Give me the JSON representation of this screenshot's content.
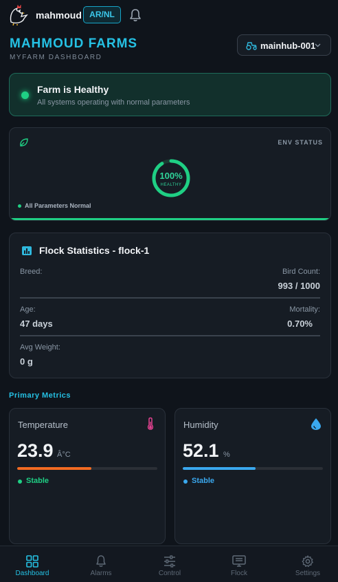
{
  "topbar": {
    "username": "mahmoud",
    "lang_label": "AR/NL"
  },
  "header": {
    "farm_name": "MAHMOUD FARMS",
    "subtitle": "MYFARM DASHBOARD",
    "hub": "mainhub-001"
  },
  "health": {
    "title": "Farm is Healthy",
    "subtitle": "All systems operating with normal parameters"
  },
  "env": {
    "status_label": "ENV STATUS",
    "percent_text": "100%",
    "percent_value": 100,
    "state_label": "HEALTHY",
    "note": "All Parameters Normal"
  },
  "flock": {
    "title": "Flock Statistics - flock-1",
    "breed_label": "Breed:",
    "breed_value": "",
    "bird_count_label": "Bird Count:",
    "bird_count_value": "993 / 1000",
    "age_label": "Age:",
    "age_value": "47 days",
    "mortality_label": "Mortality:",
    "mortality_value": "0.70%",
    "avg_weight_label": "Avg Weight:",
    "avg_weight_value": "0 g"
  },
  "primary_metrics": {
    "title": "Primary Metrics",
    "temperature": {
      "name": "Temperature",
      "value": "23.9",
      "unit": "Â°C",
      "fill": 0.53,
      "status": "Stable",
      "bar_color": "#f26b22",
      "status_color": "#1fcf84"
    },
    "humidity": {
      "name": "Humidity",
      "value": "52.1",
      "unit": "%",
      "fill": 0.52,
      "status": "Stable",
      "bar_color": "#3aa8ee",
      "status_color": "#3aa8ee"
    }
  },
  "nav": {
    "items": [
      {
        "label": "Dashboard",
        "icon": "grid-icon",
        "active": true
      },
      {
        "label": "Alarms",
        "icon": "bell-icon",
        "active": false
      },
      {
        "label": "Control",
        "icon": "sliders-icon",
        "active": false
      },
      {
        "label": "Flock",
        "icon": "monitor-icon",
        "active": false
      },
      {
        "label": "Settings",
        "icon": "gear-icon",
        "active": false
      }
    ]
  },
  "colors": {
    "accent": "#25c1e4",
    "healthy": "#1fcf84",
    "card_bg": "#161c24",
    "page_bg": "#0f141b"
  }
}
